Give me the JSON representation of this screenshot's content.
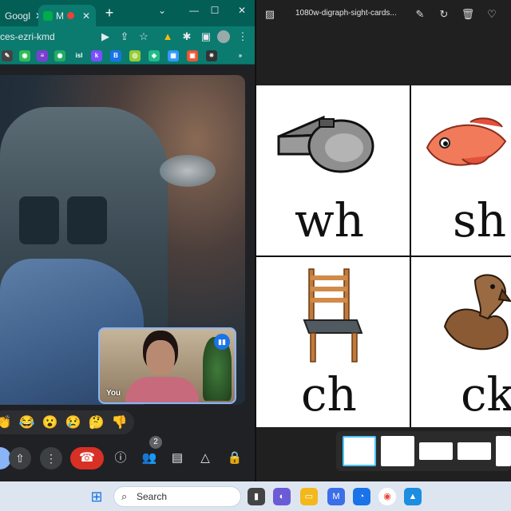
{
  "chrome": {
    "tabs": [
      {
        "label": "Googl",
        "close": "✕"
      },
      {
        "label": "M",
        "close": "✕"
      }
    ],
    "new_tab": "+",
    "window_controls": {
      "minimize": "—",
      "maximize": "☐",
      "close": "✕",
      "dropdown": "⌄"
    },
    "address": "ces-ezri-kmd",
    "colors": {
      "tabstrip": "#035e56",
      "toolbar": "#0b7b70"
    }
  },
  "meet": {
    "self_label": "You",
    "reactions": [
      "👏",
      "😂",
      "😮",
      "😢",
      "🤔",
      "👎"
    ],
    "people_count": "2"
  },
  "viewer": {
    "title": "1080w-digraph-sight-cards...",
    "cards": [
      {
        "word": "wh",
        "image": "whistle"
      },
      {
        "word": "sh",
        "image": "fish"
      },
      {
        "word": "ch",
        "image": "chair"
      },
      {
        "word": "ck",
        "image": "duck"
      }
    ]
  },
  "taskbar": {
    "search_placeholder": "Search"
  }
}
